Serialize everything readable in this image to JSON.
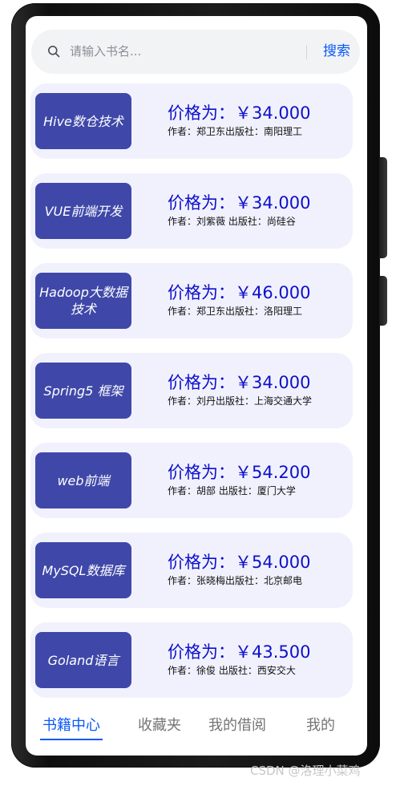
{
  "search": {
    "placeholder": "请输入书名...",
    "button_label": "搜索"
  },
  "books": [
    {
      "cover_title": "Hive数仓技术",
      "price": "价格为：￥34.000",
      "meta": "作者：郑卫东出版社：南阳理工"
    },
    {
      "cover_title": "VUE前端开发",
      "price": "价格为：￥34.000",
      "meta": "作者：刘紫薇 出版社：尚硅谷"
    },
    {
      "cover_title": "Hadoop大数据技术",
      "price": "价格为：￥46.000",
      "meta": "作者：郑卫东出版社：洛阳理工"
    },
    {
      "cover_title": "Spring5 框架",
      "price": "价格为：￥34.000",
      "meta": "作者：刘丹出版社：上海交通大学"
    },
    {
      "cover_title": "web前端",
      "price": "价格为：￥54.200",
      "meta": "作者：胡部 出版社：厦门大学"
    },
    {
      "cover_title": "MySQL数据库",
      "price": "价格为：￥54.000",
      "meta": "作者：张晓梅出版社：北京邮电"
    },
    {
      "cover_title": "Goland语言",
      "price": "价格为：￥43.500",
      "meta": "作者：徐俊 出版社：西安交大"
    }
  ],
  "tabs": [
    {
      "label": "书籍中心",
      "active": true
    },
    {
      "label": "收藏夹",
      "active": false
    },
    {
      "label": "我的借阅",
      "active": false
    },
    {
      "label": "我的",
      "active": false
    }
  ],
  "watermark": "CSDN @洛理小菜鸡",
  "colors": {
    "accent": "#0a59f7",
    "price": "#0d10c9",
    "cover": "#3f48a8",
    "card_bg": "#f1f1fe"
  }
}
